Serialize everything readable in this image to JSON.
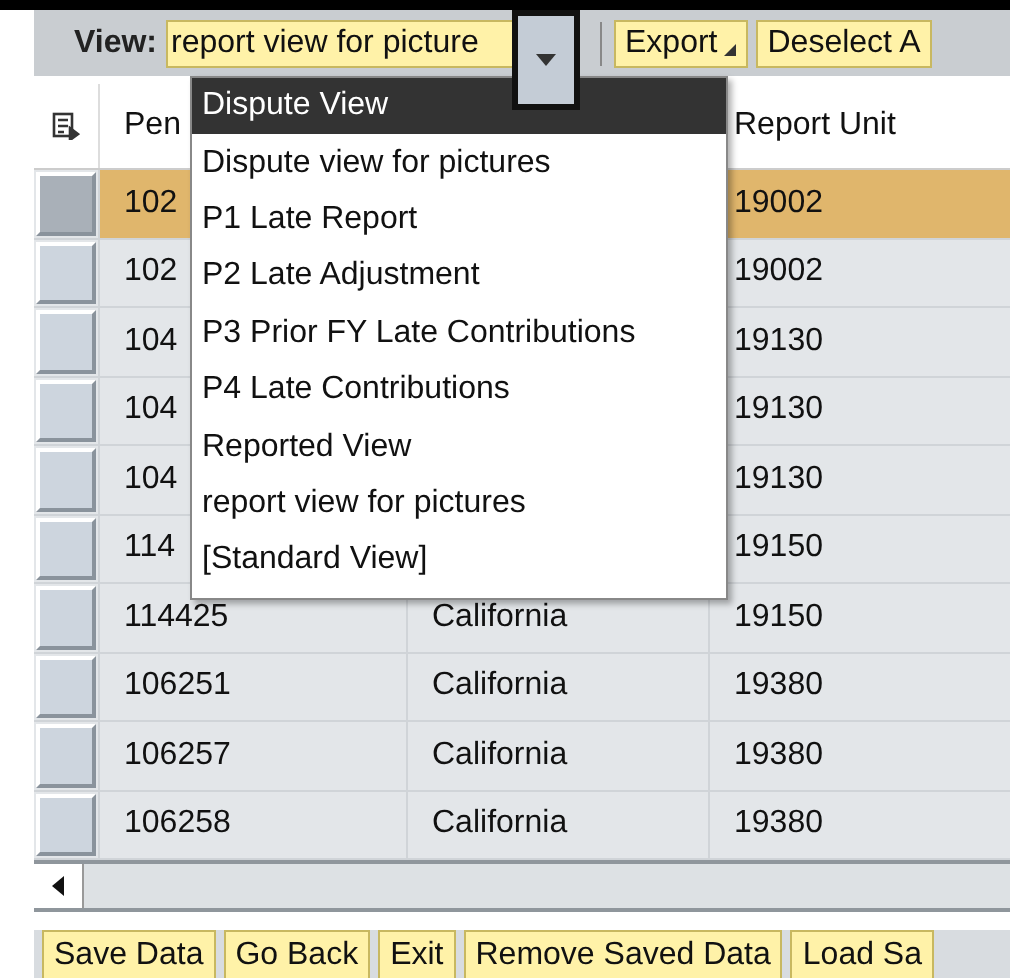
{
  "toolbar": {
    "view_label": "View:",
    "view_value": "report view for picture",
    "dropdown_button_focused": true,
    "buttons": [
      {
        "label": "Export",
        "has_menu": true
      },
      {
        "label": "Deselect A",
        "has_menu": false
      }
    ]
  },
  "view_menu": {
    "open": true,
    "items": [
      {
        "label": "Dispute View",
        "selected": true
      },
      {
        "label": "Dispute view for pictures",
        "selected": false
      },
      {
        "label": "P1 Late Report",
        "selected": false
      },
      {
        "label": "P2 Late Adjustment",
        "selected": false
      },
      {
        "label": "P3 Prior FY Late Contributions",
        "selected": false
      },
      {
        "label": "P4 Late Contributions",
        "selected": false
      },
      {
        "label": "Reported View",
        "selected": false
      },
      {
        "label": "report view for pictures",
        "selected": false
      },
      {
        "label": "[Standard View]",
        "selected": false
      }
    ]
  },
  "table": {
    "columns": [
      "Pen",
      null,
      "Report Unit"
    ],
    "rows": [
      {
        "cells": [
          "102",
          null,
          "19002"
        ],
        "selected": true
      },
      {
        "cells": [
          "102",
          null,
          "19002"
        ],
        "selected": false
      },
      {
        "cells": [
          "104",
          null,
          "19130"
        ],
        "selected": false
      },
      {
        "cells": [
          "104",
          null,
          "19130"
        ],
        "selected": false
      },
      {
        "cells": [
          "104",
          null,
          "19130"
        ],
        "selected": false
      },
      {
        "cells": [
          "114",
          null,
          "19150"
        ],
        "selected": false
      },
      {
        "cells": [
          "114425",
          "California",
          "19150"
        ],
        "selected": false
      },
      {
        "cells": [
          "106251",
          "California",
          "19380"
        ],
        "selected": false
      },
      {
        "cells": [
          "106257",
          "California",
          "19380"
        ],
        "selected": false
      },
      {
        "cells": [
          "106258",
          "California",
          "19380"
        ],
        "selected": false
      }
    ]
  },
  "footer_buttons": [
    "Save Data",
    "Go Back",
    "Exit",
    "Remove Saved Data",
    "Load Sa"
  ]
}
